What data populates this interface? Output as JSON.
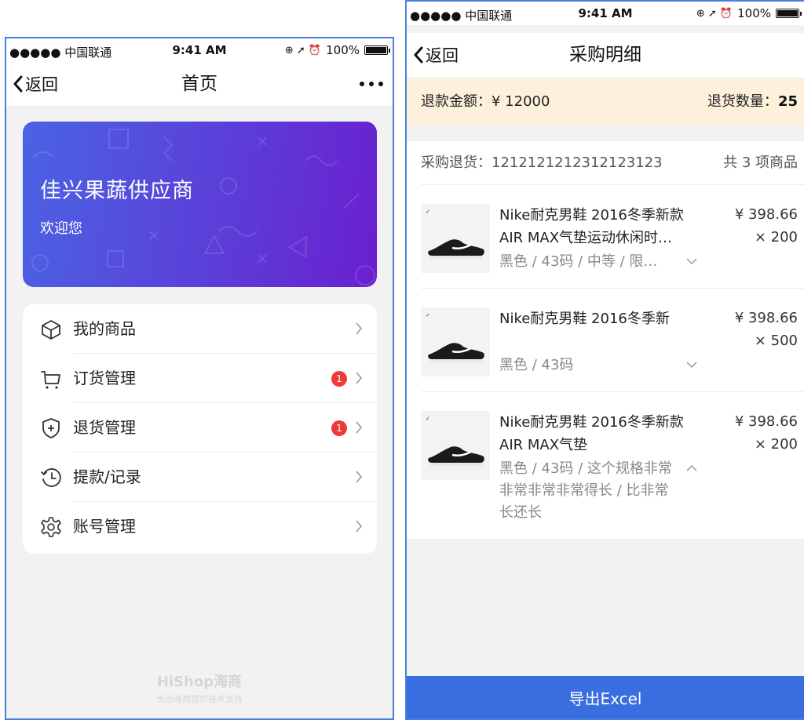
{
  "status_bar": {
    "carrier": "●●●●● 中国联通",
    "time": "9:41 AM",
    "battery": "100%"
  },
  "home": {
    "nav": {
      "back_label": "返回",
      "title": "首页"
    },
    "banner": {
      "name": "佳兴果蔬供应商",
      "welcome": "欢迎您"
    },
    "menu": [
      {
        "label": "我的商品",
        "icon": "box-icon",
        "badge": ""
      },
      {
        "label": "订货管理",
        "icon": "cart-icon",
        "badge": "1"
      },
      {
        "label": "退货管理",
        "icon": "shield-plus-icon",
        "badge": "1"
      },
      {
        "label": "提款/记录",
        "icon": "clock-icon",
        "badge": ""
      },
      {
        "label": "账号管理",
        "icon": "gear-icon",
        "badge": ""
      }
    ],
    "footer": {
      "logo": "HiShop海商",
      "support": "长沙海商提供技术支持"
    }
  },
  "detail": {
    "nav": {
      "back_label": "返回",
      "title": "采购明细"
    },
    "refund": {
      "amount_label": "退款金额：¥ 12000",
      "qty_label": "退货数量：",
      "qty_value": "25"
    },
    "order": {
      "number_label": "采购退货：1212121212312123123",
      "count_label": "共 3 项商品"
    },
    "products": [
      {
        "title": "Nike耐克男鞋 2016冬季新款AIR MAX气垫运动休闲时…",
        "price": "¥ 398.66",
        "qty": "× 200",
        "spec": "黑色 / 43码 / 中等 / 限…",
        "toggle": "chevron-down-icon"
      },
      {
        "title": "Nike耐克男鞋 2016冬季新",
        "price": "¥ 398.66",
        "qty": "× 500",
        "spec": "黑色 / 43码",
        "toggle": "chevron-down-icon"
      },
      {
        "title": "Nike耐克男鞋 2016冬季新款AIR MAX气垫",
        "price": "¥ 398.66",
        "qty": "× 200",
        "spec": "黑色 / 43码 / 这个规格非常非常非常非常得长 / 比非常长还长",
        "toggle": "chevron-up-icon"
      }
    ],
    "export_label": "导出Excel"
  },
  "colors": {
    "accent": "#3a6ee0",
    "badge": "#f03a3a",
    "refund_bg": "#fdf1dc",
    "banner_start": "#4a63e4",
    "banner_end": "#6a1fce"
  }
}
